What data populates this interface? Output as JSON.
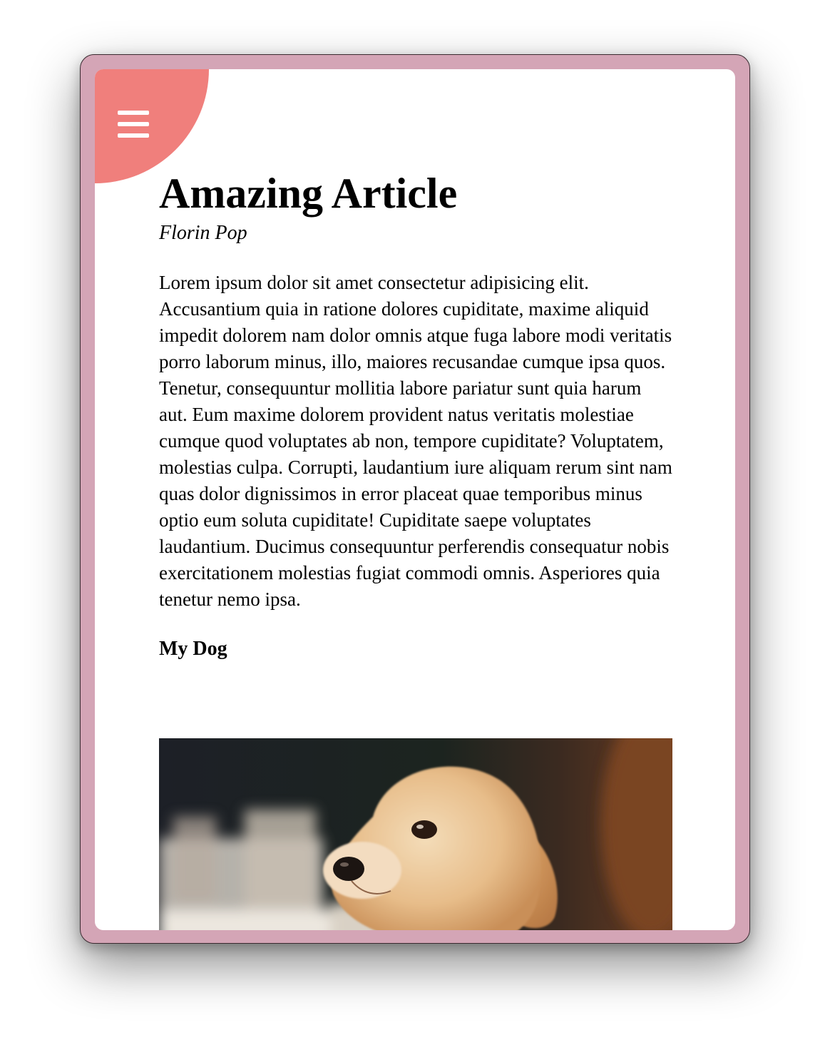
{
  "article": {
    "title": "Amazing Article",
    "author": "Florin Pop",
    "body": "Lorem ipsum dolor sit amet consectetur adipisicing elit. Accusantium quia in ratione dolores cupiditate, maxime aliquid impedit dolorem nam dolor omnis atque fuga labore modi veritatis porro laborum minus, illo, maiores recusandae cumque ipsa quos. Tenetur, consequuntur mollitia labore pariatur sunt quia harum aut. Eum maxime dolorem provident natus veritatis molestiae cumque quod voluptates ab non, tempore cupiditate? Voluptatem, molestias culpa. Corrupti, laudantium iure aliquam rerum sint nam quas dolor dignissimos in error placeat quae temporibus minus optio eum soluta cupiditate! Cupiditate saepe voluptates laudantium. Ducimus consequuntur perferendis consequatur nobis exercitationem molestias fugiat commodi omnis. Asperiores quia tenetur nemo ipsa.",
    "subheading": "My Dog"
  },
  "colors": {
    "frame": "#d4a5b6",
    "menu_accent": "#f07f7c"
  },
  "icons": {
    "menu": "hamburger-menu-icon"
  }
}
